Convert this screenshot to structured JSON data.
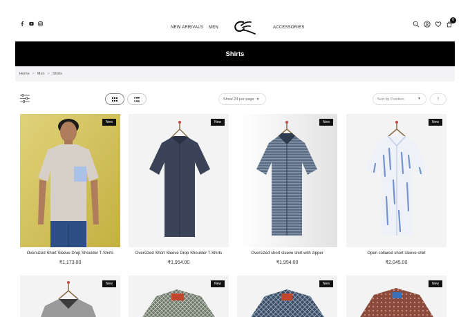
{
  "header": {
    "social": [
      {
        "icon": "facebook-icon",
        "label": "f"
      },
      {
        "icon": "youtube-icon",
        "label": "▶"
      },
      {
        "icon": "instagram-icon",
        "label": "◎"
      }
    ],
    "nav": {
      "new_arrivals": "NEW ARRIVALS",
      "men": "MEN",
      "accessories": "ACCESSORIES"
    },
    "logo_icon": "brand-logo",
    "icons": [
      "search-icon",
      "user-icon",
      "heart-icon",
      "cart-icon"
    ],
    "cart_count": "0"
  },
  "page": {
    "title": "Shirts"
  },
  "breadcrumb": {
    "home": "Home",
    "men": "Men",
    "current": "Shirts",
    "separator": ">"
  },
  "toolbar": {
    "per_page": "Show 24 per page",
    "sort_by": "Sort by Position",
    "sort_direction": "↑"
  },
  "colors": {
    "title_bar": "#000000",
    "breadcrumb_bg": "#f4f4f6",
    "badge_bg": "#111111"
  },
  "products": [
    {
      "badge": "New",
      "name": "Oversized Short Sleeve Drop Shoulder T-Shirts",
      "price": "₹1,173.00"
    },
    {
      "badge": "New",
      "name": "Oversized Short Sleeve Drop Shoulder T-Shirts",
      "price": "₹1,954.00"
    },
    {
      "badge": "New",
      "name": "Oversized short sleeve shirt with zipper",
      "price": "₹1,954.00"
    },
    {
      "badge": "New",
      "name": "Open collared short sleeve shirt",
      "price": "₹2,045.00"
    },
    {
      "badge": "New",
      "name": "",
      "price": ""
    },
    {
      "badge": "New",
      "name": "",
      "price": ""
    },
    {
      "badge": "New",
      "name": "",
      "price": ""
    },
    {
      "badge": "New",
      "name": "",
      "price": ""
    }
  ]
}
